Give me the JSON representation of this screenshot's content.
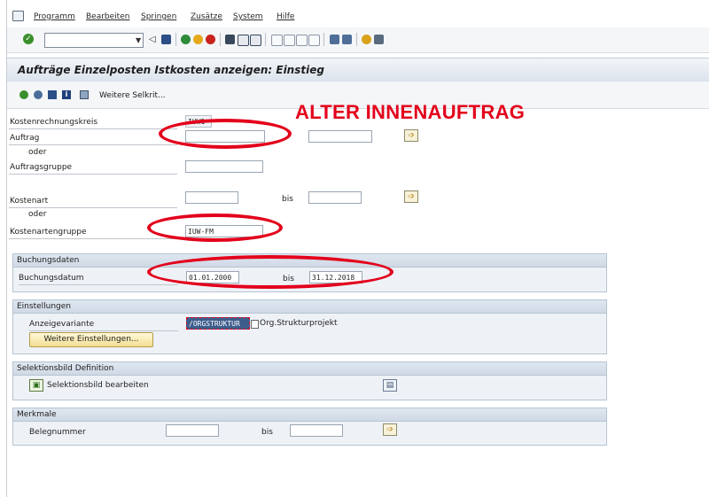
{
  "menu": {
    "items": [
      "Programm",
      "Bearbeiten",
      "Springen",
      "Zusätze",
      "System",
      "Hilfe"
    ]
  },
  "toolbar": {
    "command_value": ""
  },
  "title": "Aufträge Einzelposten Istkosten anzeigen: Einstieg",
  "app_toolbar": {
    "weitere_selkrit_label": "Weitere Selkrit..."
  },
  "form": {
    "kostenrechnungskreis": {
      "label": "Kostenrechnungskreis",
      "value": "IUW1"
    },
    "auftrag": {
      "label": "Auftrag",
      "from": "",
      "to": ""
    },
    "oder1": "oder",
    "auftragsgruppe": {
      "label": "Auftragsgruppe",
      "value": ""
    },
    "kostenart": {
      "label": "Kostenart",
      "from": "",
      "bis_label": "bis",
      "to": ""
    },
    "oder2": "oder",
    "kostenartengruppe": {
      "label": "Kostenartengruppe",
      "value": "IUW-FM"
    }
  },
  "buchungsdaten": {
    "title": "Buchungsdaten",
    "label": "Buchungsdatum",
    "from": "01.01.2000",
    "bis_label": "bis",
    "to": "31.12.2018"
  },
  "einstellungen": {
    "title": "Einstellungen",
    "anzeigevariante_label": "Anzeigevariante",
    "anzeigevariante_value": "/ORGSTRUKTUR",
    "anzeigevariante_text": "Org.Strukturprojekt",
    "weitere_button": "Weitere Einstellungen..."
  },
  "selektionsbild": {
    "title": "Selektionsbild Definition",
    "button_label": "Selektionsbild bearbeiten"
  },
  "merkmale": {
    "title": "Merkmale",
    "belegnummer_label": "Belegnummer",
    "from": "",
    "bis_label": "bis",
    "to": ""
  },
  "annotation": "ALTER INNENAUFTRAG",
  "colors": {
    "annotation": "#e3001b",
    "group_background": "#eef2f6",
    "title_bar": "#dbe3ec"
  }
}
